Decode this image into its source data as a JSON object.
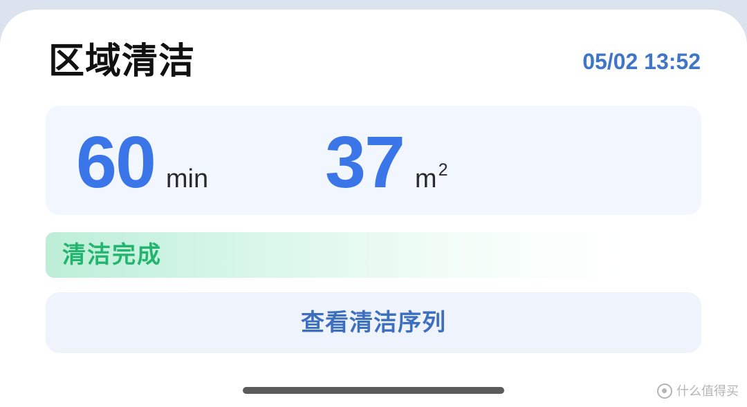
{
  "header": {
    "title": "区域清洁",
    "timestamp": "05/02 13:52"
  },
  "stats": {
    "duration": {
      "value": "60",
      "unit": "min"
    },
    "area": {
      "value": "37",
      "unit_base": "m",
      "unit_superscript": "2"
    }
  },
  "status": {
    "label": "清洁完成"
  },
  "actions": {
    "view_sequence_label": "查看清洁序列"
  },
  "watermark": {
    "text": "什么值得买"
  },
  "colors": {
    "accent_blue": "#3b76e8",
    "timestamp_blue": "#3f76c8",
    "status_green": "#23b56f",
    "card_bg": "#f1f6ff",
    "button_bg": "#eef3fc",
    "page_bg": "#dbe3ee"
  },
  "icons": {
    "watermark_icon": "brand-mark-icon"
  }
}
